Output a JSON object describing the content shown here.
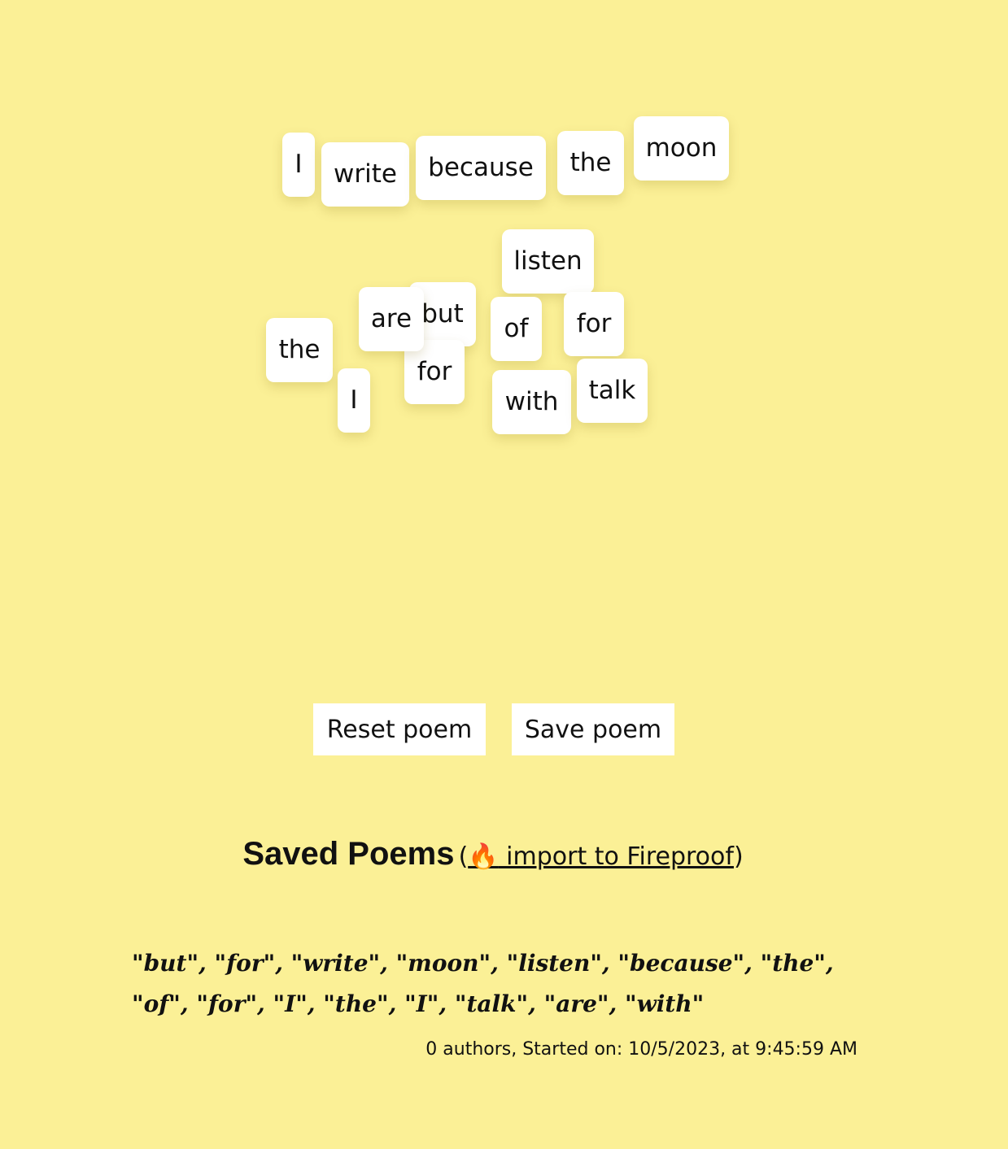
{
  "board": {
    "words": [
      "I",
      "write",
      "because",
      "the",
      "moon",
      "listen",
      "are",
      "but",
      "of",
      "for",
      "the",
      "for",
      "I",
      "with",
      "talk"
    ]
  },
  "actions": {
    "reset_label": "Reset poem",
    "save_label": "Save poem"
  },
  "saved": {
    "heading": "Saved Poems",
    "paren_open": "(",
    "fire_icon": "🔥",
    "import_label": " import to Fireproof",
    "paren_close": ")",
    "poems": [
      {
        "text": "\"but\", \"for\", \"write\", \"moon\", \"listen\", \"because\", \"the\", \"of\", \"for\", \"I\", \"the\", \"I\", \"talk\", \"are\", \"with\"",
        "meta": "0 authors, Started on: 10/5/2023, at 9:45:59 AM"
      }
    ]
  },
  "colors": {
    "background": "#fbf096",
    "tile": "#ffffff",
    "text": "#111111"
  }
}
